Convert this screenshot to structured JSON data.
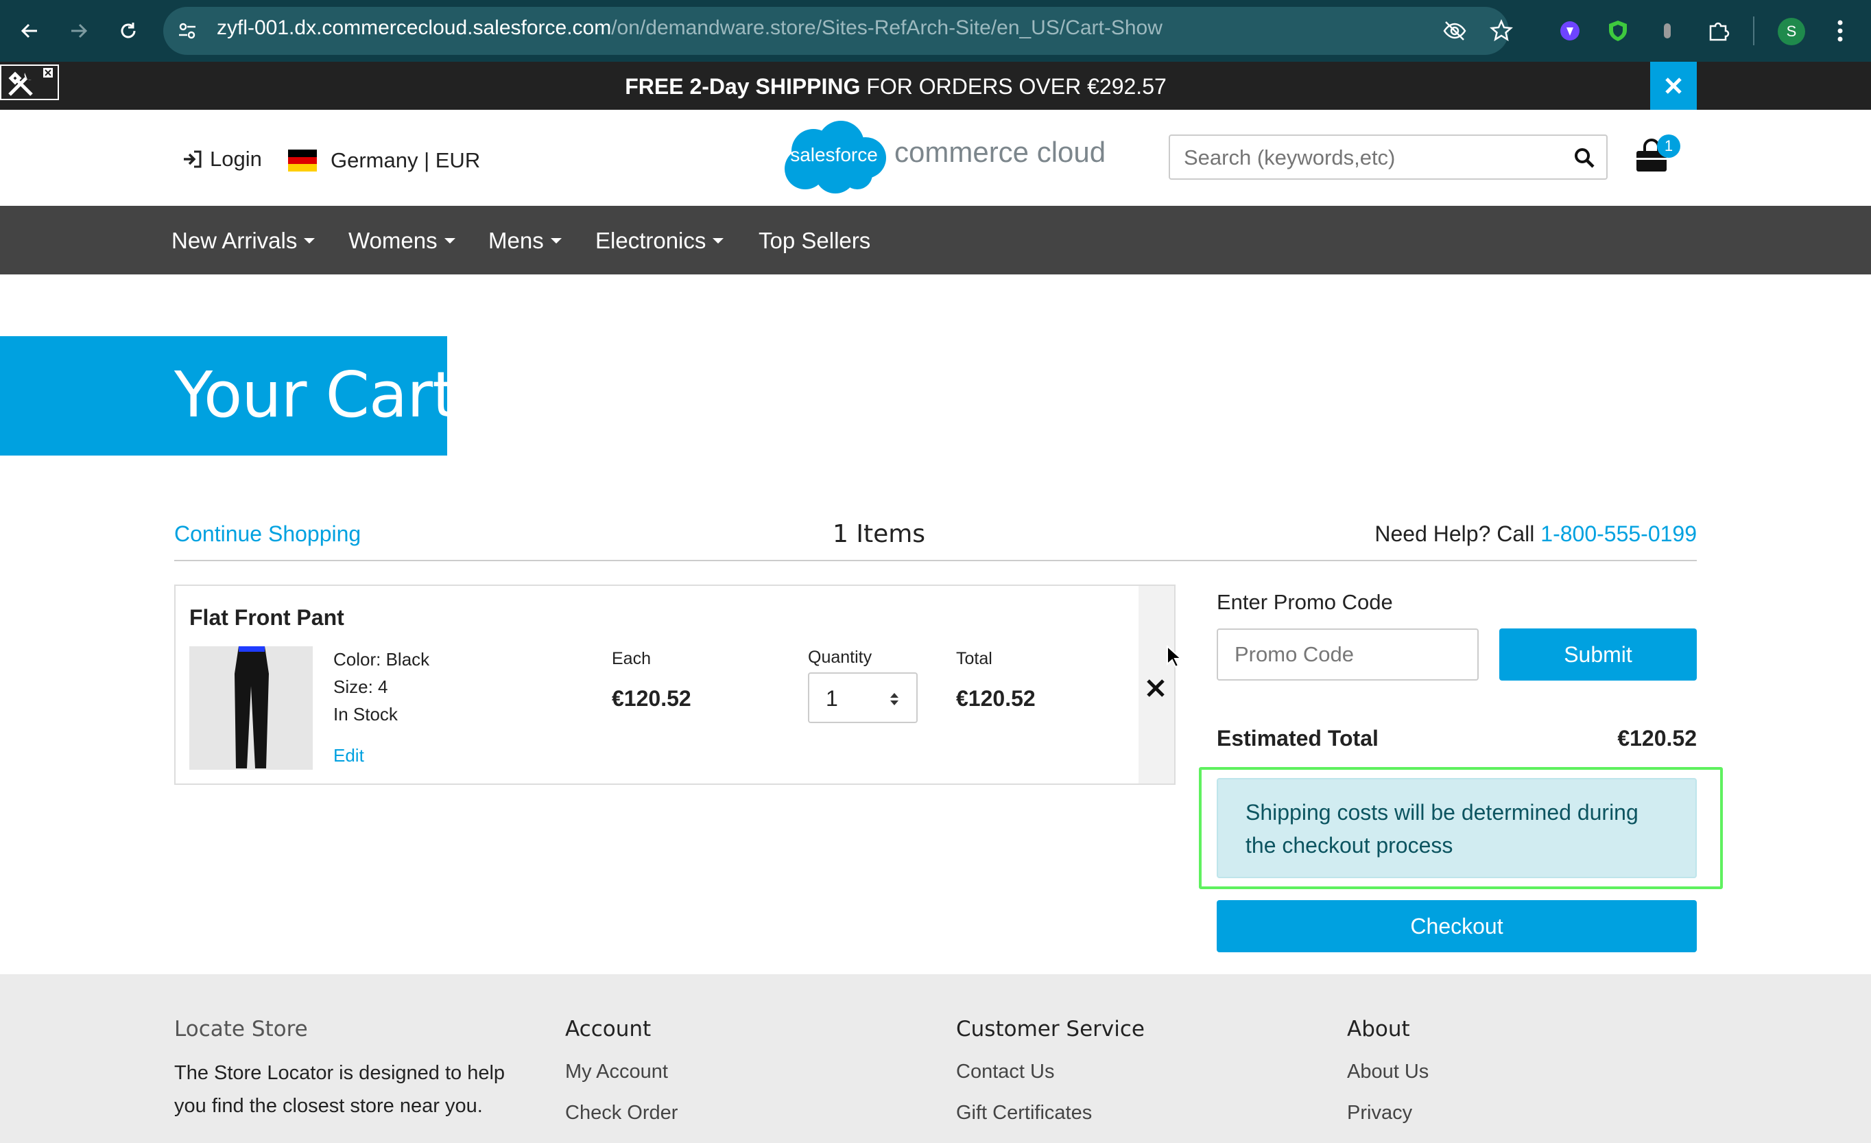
{
  "browser": {
    "url_host": "zyfl-001.dx.commercecloud.salesforce.com",
    "url_path": "/on/demandware.store/Sites-RefArch-Site/en_US/Cart-Show",
    "profile_initial": "S"
  },
  "promo_banner": {
    "bold": "FREE 2-Day SHIPPING",
    "rest": " FOR ORDERS OVER €292.57"
  },
  "header": {
    "login_label": "Login",
    "locale_label": "Germany | EUR",
    "logo_cloud_text": "salesforce",
    "logo_text": "commerce cloud",
    "search_placeholder": "Search (keywords,etc)",
    "cart_count": "1"
  },
  "nav": {
    "items": [
      {
        "label": "New Arrivals"
      },
      {
        "label": "Womens"
      },
      {
        "label": "Mens"
      },
      {
        "label": "Electronics"
      },
      {
        "label": "Top Sellers"
      }
    ]
  },
  "page": {
    "title": "Your Cart",
    "continue_shopping": "Continue Shopping",
    "items_count": "1 Items",
    "help_prefix": "Need Help? Call ",
    "help_phone": "1-800-555-0199"
  },
  "product": {
    "name": "Flat Front Pant",
    "color": "Color: Black",
    "size": "Size: 4",
    "stock": "In Stock",
    "edit_label": "Edit",
    "each_label": "Each",
    "each_price": "€120.52",
    "quantity_label": "Quantity",
    "quantity": "1",
    "total_label": "Total",
    "total_price": "€120.52"
  },
  "summary": {
    "promo_label": "Enter Promo Code",
    "promo_placeholder": "Promo Code",
    "submit_label": "Submit",
    "estimated_total_label": "Estimated Total",
    "estimated_total": "€120.52",
    "shipping_note": "Shipping costs will be determined during the checkout process",
    "checkout_label": "Checkout"
  },
  "footer": {
    "locate_heading": "Locate Store",
    "locate_text": "The Store Locator is designed to help you find the closest store near you.",
    "account_heading": "Account",
    "account_links": [
      "My Account",
      "Check Order"
    ],
    "service_heading": "Customer Service",
    "service_links": [
      "Contact Us",
      "Gift Certificates"
    ],
    "about_heading": "About",
    "about_links": [
      "About Us",
      "Privacy"
    ]
  },
  "colors": {
    "accent": "#00a1e0",
    "nav_bg": "#444444",
    "alert_bg": "#d1ecf1",
    "highlight": "#5ff15f"
  }
}
